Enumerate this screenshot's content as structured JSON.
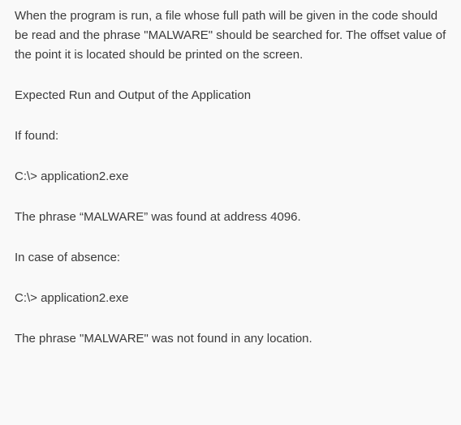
{
  "paragraphs": {
    "intro": "When the program is run, a file whose full path will be given in the code should be read and the phrase \"MALWARE\" should be searched for. The offset value of the point it is located should be printed on the screen.",
    "expected_header": "Expected Run and Output of the Application",
    "if_found_label": "If found:",
    "found_cmd": "C:\\> application2.exe",
    "found_output": "The phrase “MALWARE” was found at address 4096.",
    "absence_label": "In case of absence:",
    "absence_cmd": "C:\\> application2.exe",
    "absence_output": "The phrase \"MALWARE\" was not found in any location."
  }
}
